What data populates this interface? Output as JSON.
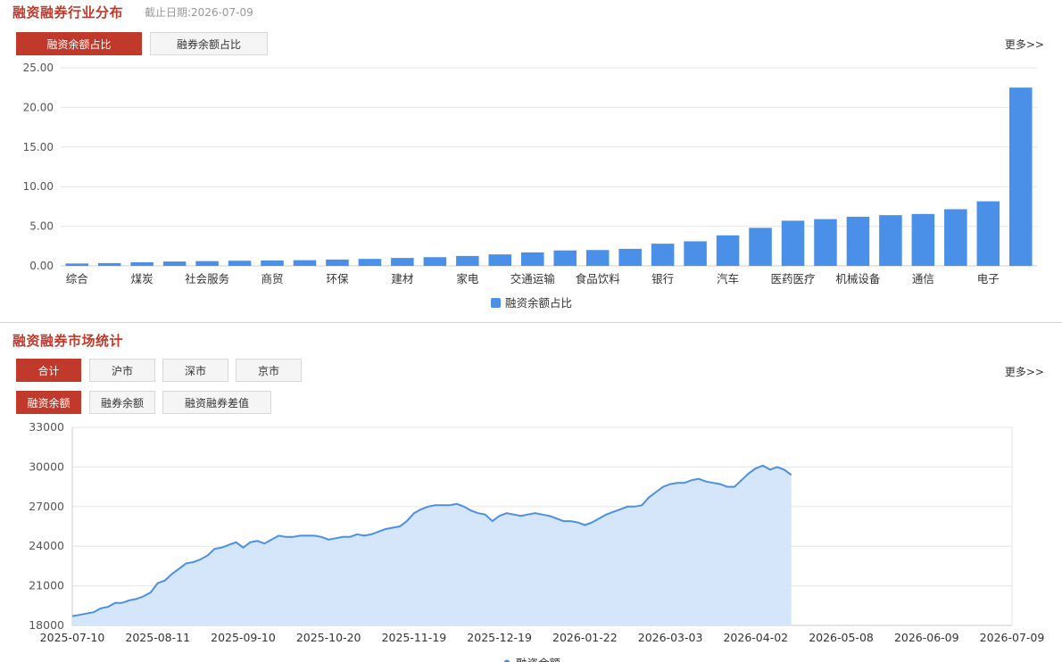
{
  "industry_section": {
    "title": "融资融券行业分布",
    "as_of_label": "截止日期:",
    "as_of_date": "2026-07-09",
    "tabs": [
      "融资余额占比",
      "融券余额占比"
    ],
    "active_tab": 0,
    "more_label": "更多>>"
  },
  "market_section": {
    "title": "融资融券市场统计",
    "market_tabs": [
      "合计",
      "沪市",
      "深市",
      "京市"
    ],
    "active_market_tab": 0,
    "metric_tabs": [
      "融资余额",
      "融券余额",
      "融资融券差值"
    ],
    "active_metric_tab": 0,
    "more_label": "更多>>"
  },
  "colors": {
    "accent": "#c0392b",
    "bar": "#4a90e8",
    "line": "#4a90e8",
    "area": "#d6e6fa"
  },
  "chart_data": [
    {
      "type": "bar",
      "categories": [
        "综合",
        "",
        "煤炭",
        "",
        "社会服务",
        "",
        "商贸",
        "",
        "环保",
        "",
        "建材",
        "",
        "家电",
        "",
        "交通运输",
        "",
        "食品饮料",
        "",
        "银行",
        "",
        "汽车",
        "",
        "医药医疗",
        "",
        "机械设备",
        "",
        "通信",
        "",
        "电子"
      ],
      "values": [
        0.3,
        0.35,
        0.45,
        0.55,
        0.6,
        0.65,
        0.68,
        0.72,
        0.8,
        0.88,
        1.0,
        1.1,
        1.25,
        1.45,
        1.7,
        1.95,
        2.0,
        2.15,
        2.8,
        3.1,
        3.85,
        4.8,
        5.7,
        5.9,
        6.2,
        6.4,
        6.55,
        7.15,
        8.15,
        22.5
      ],
      "title": "",
      "xlabel": "",
      "ylabel": "",
      "ylim": [
        0,
        25
      ],
      "yticks": [
        "0.00",
        "5.00",
        "10.00",
        "15.00",
        "20.00",
        "25.00"
      ],
      "legend": "融资余额占比",
      "grid": true
    },
    {
      "type": "area",
      "series_name": "融资余额",
      "ylim": [
        18000,
        33000
      ],
      "yticks": [
        "18000",
        "21000",
        "24000",
        "27000",
        "30000",
        "33000"
      ],
      "xticks": [
        "2025-07-10",
        "2025-08-11",
        "2025-09-10",
        "2025-10-20",
        "2025-11-19",
        "2025-12-19",
        "2026-01-22",
        "2026-03-03",
        "2026-04-02",
        "2026-05-08",
        "2026-06-09",
        "2026-07-09"
      ],
      "x": [
        0,
        2,
        4,
        6,
        8,
        10,
        12,
        14,
        16,
        18,
        20,
        22,
        24,
        26,
        28,
        30,
        32,
        34,
        36,
        38,
        40,
        42,
        44,
        46,
        48,
        50,
        52,
        54,
        56,
        58,
        60,
        62,
        64,
        66,
        68,
        70,
        72,
        74,
        76,
        78,
        80,
        82,
        84,
        86,
        88,
        90,
        92,
        94,
        96,
        98,
        100,
        102,
        104,
        106,
        108,
        110,
        112,
        114,
        116,
        118,
        120,
        122,
        124,
        126,
        128,
        130,
        132,
        134,
        136,
        138,
        140,
        142,
        144,
        146,
        148,
        150,
        152,
        154,
        156,
        158,
        160,
        162,
        164,
        166,
        168,
        170,
        172,
        174,
        176,
        178,
        180,
        182,
        184,
        186,
        188,
        190,
        192,
        194,
        196,
        198,
        200,
        202,
        204,
        206,
        208,
        210,
        212,
        214,
        216,
        218,
        220,
        222,
        224,
        226,
        228,
        230,
        232,
        234,
        236,
        238,
        240,
        242,
        244,
        246,
        248,
        250,
        252,
        254,
        256,
        258,
        260,
        262,
        264
      ],
      "values": [
        18700,
        18800,
        18900,
        19000,
        19300,
        19400,
        19700,
        19700,
        19900,
        20000,
        20200,
        20500,
        21200,
        21400,
        21900,
        22300,
        22700,
        22800,
        23000,
        23300,
        23800,
        23900,
        24100,
        24300,
        23900,
        24300,
        24400,
        24200,
        24500,
        24800,
        24700,
        24700,
        24800,
        24800,
        24800,
        24700,
        24500,
        24600,
        24700,
        24700,
        24900,
        24800,
        24900,
        25100,
        25300,
        25400,
        25500,
        25900,
        26500,
        26800,
        27000,
        27100,
        27100,
        27100,
        27200,
        27000,
        26700,
        26500,
        26400,
        25900,
        26300,
        26500,
        26400,
        26300,
        26400,
        26500,
        26400,
        26300,
        26100,
        25900,
        25900,
        25800,
        25600,
        25800,
        26100,
        26400,
        26600,
        26800,
        27000,
        27000,
        27100,
        27700,
        28100,
        28500,
        28700,
        28800,
        28800,
        29000,
        29100,
        28900,
        28800,
        28700,
        28500,
        28500,
        29000,
        29500,
        29900,
        30100,
        29800,
        30000,
        29800,
        29400
      ]
    }
  ]
}
